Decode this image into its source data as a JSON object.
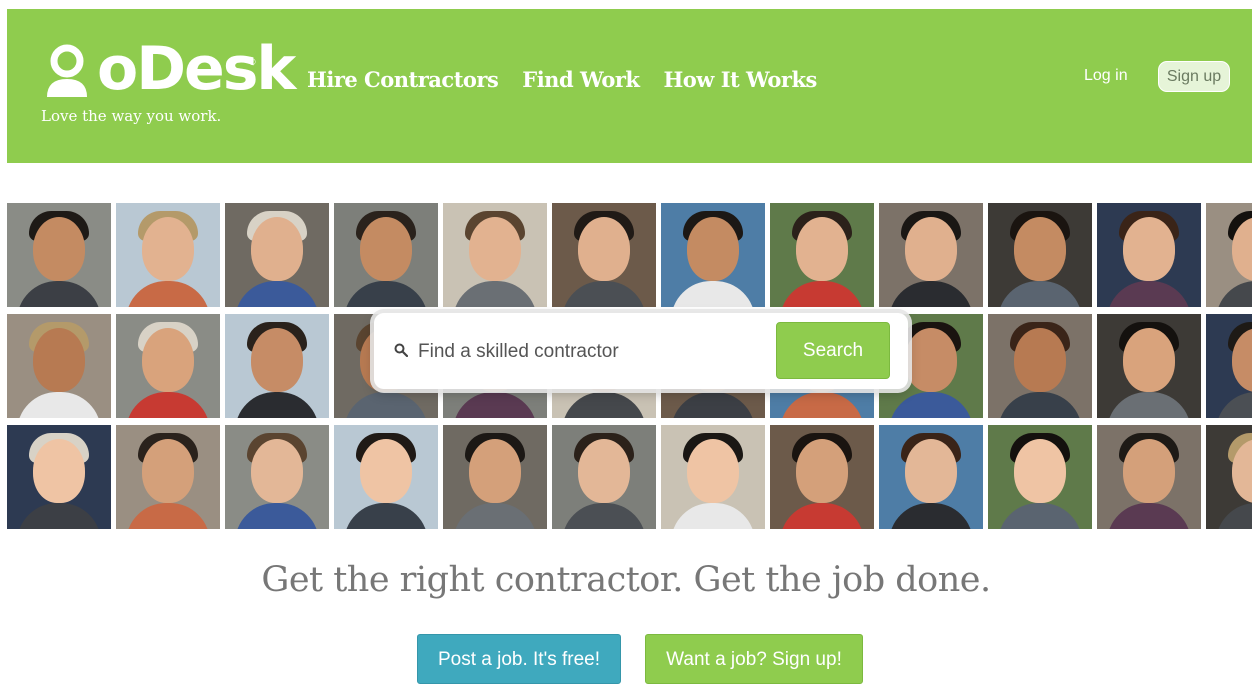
{
  "header": {
    "logo_text": "oDesk",
    "logo_registered": "®",
    "tagline": "Love the way you work.",
    "nav": [
      {
        "label": "Hire Contractors"
      },
      {
        "label": "Find Work"
      },
      {
        "label": "How It Works"
      }
    ],
    "login_label": "Log in",
    "signup_label": "Sign up"
  },
  "search": {
    "placeholder": "Find a skilled contractor",
    "button_label": "Search"
  },
  "headline": "Get the right contractor. Get the job done.",
  "ctas": {
    "post_job_label": "Post a job. It's free!",
    "want_job_label": "Want a job? Sign up!"
  },
  "colors": {
    "brand_green": "#8fcc4e",
    "cta_blue": "#3fa9be",
    "headline_gray": "#777777"
  },
  "icons": {
    "logo": "odesk-person-icon",
    "search": "search-icon"
  }
}
